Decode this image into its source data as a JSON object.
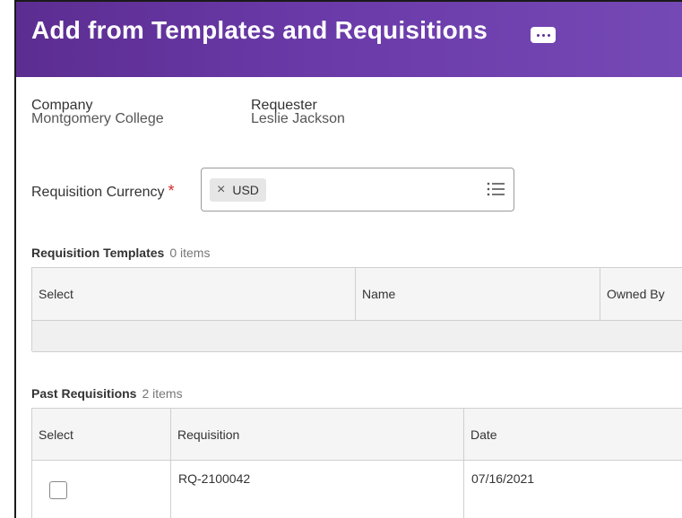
{
  "header": {
    "title": "Add from Templates and Requisitions",
    "more_icon": "more-ellipsis-icon"
  },
  "company": {
    "label": "Company",
    "value": "Montgomery College"
  },
  "requester": {
    "label": "Requester",
    "value": "Leslie Jackson"
  },
  "currency": {
    "label": "Requisition Currency",
    "required_marker": "*",
    "selected": "USD",
    "remove_glyph": "×",
    "list_icon": "list-icon"
  },
  "templates": {
    "title": "Requisition Templates",
    "count": "0 items",
    "columns": [
      "Select",
      "Name",
      "Owned By"
    ]
  },
  "past": {
    "title": "Past Requisitions",
    "count": "2 items",
    "columns": [
      "Select",
      "Requisition",
      "Date"
    ],
    "rows": [
      {
        "requisition": "RQ-2100042",
        "date": "07/16/2021"
      }
    ]
  },
  "colors": {
    "header": "#5c2d91",
    "required": "#d12b2b"
  }
}
